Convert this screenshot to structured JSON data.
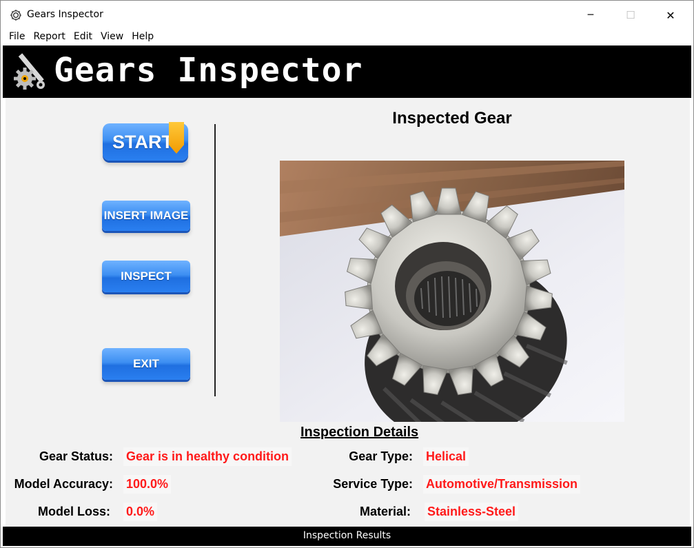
{
  "window": {
    "title": "Gears Inspector",
    "minimize_label": "─",
    "maximize_label": "☐",
    "close_label": "✕"
  },
  "menu": [
    "File",
    "Report",
    "Edit",
    "View",
    "Help"
  ],
  "banner": {
    "title": "Gears Inspector",
    "icon": "gear-wrench-icon"
  },
  "buttons": {
    "start": "START",
    "insert_image": "INSERT IMAGE",
    "inspect": "INSPECT",
    "exit": "EXIT"
  },
  "preview": {
    "heading": "Inspected Gear"
  },
  "details": {
    "heading": "Inspection Details",
    "gear_status_label": "Gear Status:",
    "gear_status_value": "Gear is in healthy condition",
    "model_accuracy_label": "Model Accuracy:",
    "model_accuracy_value": "100.0%",
    "model_loss_label": "Model Loss:",
    "model_loss_value": "0.0%",
    "gear_type_label": "Gear Type:",
    "gear_type_value": "Helical",
    "service_type_label": "Service Type:",
    "service_type_value": "Automotive/Transmission",
    "material_label": "Material:",
    "material_value": "Stainless-Steel"
  },
  "statusbar": {
    "text": "Inspection Results"
  },
  "colors": {
    "banner_bg": "#000000",
    "content_bg": "#f2f2f2",
    "value_red": "#ff1a1a",
    "button_blue": "#2a7ff0",
    "start_ribbon": "#f29a00"
  }
}
